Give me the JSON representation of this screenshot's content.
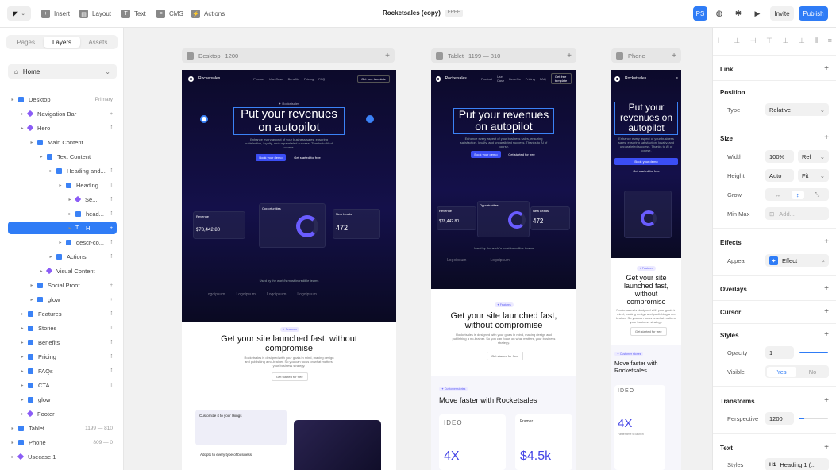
{
  "topbar": {
    "insert": "Insert",
    "layout": "Layout",
    "text": "Text",
    "cms": "CMS",
    "actions": "Actions",
    "title": "Rocketsales (copy)",
    "plan": "FREE",
    "avatar": "PS",
    "invite": "Invite",
    "publish": "Publish"
  },
  "left_panel": {
    "tabs": [
      "Pages",
      "Layers",
      "Assets"
    ],
    "page": "Home",
    "layers": [
      {
        "label": "Desktop",
        "tag": "Primary",
        "depth": 0,
        "kind": "frame"
      },
      {
        "label": "Navigation Bar",
        "tag": "+",
        "depth": 1,
        "kind": "comp"
      },
      {
        "label": "Hero",
        "tag": "⠿",
        "depth": 1,
        "kind": "comp"
      },
      {
        "label": "Main Content",
        "tag": "",
        "depth": 2,
        "kind": "stack"
      },
      {
        "label": "Text Content",
        "tag": "",
        "depth": 3,
        "kind": "stack"
      },
      {
        "label": "Heading and...",
        "tag": "⠿",
        "depth": 4,
        "kind": "stack"
      },
      {
        "label": "Heading ...",
        "tag": "⠿",
        "depth": 5,
        "kind": "stack"
      },
      {
        "label": "Se...",
        "tag": "⠿",
        "depth": 6,
        "kind": "comp"
      },
      {
        "label": "head...",
        "tag": "⠿",
        "depth": 6,
        "kind": "stack"
      },
      {
        "label": "H",
        "tag": "+",
        "depth": 6,
        "kind": "text",
        "selected": true
      },
      {
        "label": "descr-co...",
        "tag": "⠿",
        "depth": 5,
        "kind": "stack"
      },
      {
        "label": "Actions",
        "tag": "⠿",
        "depth": 4,
        "kind": "stack"
      },
      {
        "label": "Visual Content",
        "tag": "",
        "depth": 3,
        "kind": "comp"
      },
      {
        "label": "Social Proof",
        "tag": "+",
        "depth": 2,
        "kind": "stack"
      },
      {
        "label": "glow",
        "tag": "+",
        "depth": 2,
        "kind": "stack"
      },
      {
        "label": "Features",
        "tag": "⠿",
        "depth": 1,
        "kind": "stack"
      },
      {
        "label": "Stories",
        "tag": "⠿",
        "depth": 1,
        "kind": "stack"
      },
      {
        "label": "Benefits",
        "tag": "⠿",
        "depth": 1,
        "kind": "stack"
      },
      {
        "label": "Pricing",
        "tag": "⠿",
        "depth": 1,
        "kind": "stack"
      },
      {
        "label": "FAQs",
        "tag": "⠿",
        "depth": 1,
        "kind": "stack"
      },
      {
        "label": "CTA",
        "tag": "⠿",
        "depth": 1,
        "kind": "stack"
      },
      {
        "label": "glow",
        "tag": "",
        "depth": 1,
        "kind": "stack"
      },
      {
        "label": "Footer",
        "tag": "",
        "depth": 1,
        "kind": "comp"
      },
      {
        "label": "Tablet",
        "tag": "1199 — 810",
        "depth": 0,
        "kind": "frame"
      },
      {
        "label": "Phone",
        "tag": "809 — 0",
        "depth": 0,
        "kind": "frame"
      },
      {
        "label": "Usecase 1",
        "tag": "",
        "depth": 0,
        "kind": "comp"
      }
    ]
  },
  "canvas": {
    "desktop": {
      "label": "Desktop",
      "size": "1200"
    },
    "tablet": {
      "label": "Tablet",
      "size": "1199 — 810"
    },
    "phone": {
      "label": "Phone"
    },
    "site": {
      "brand": "Rocketsales",
      "nav": [
        "Product",
        "Use Case",
        "Benefits",
        "Pricing",
        "FAQ"
      ],
      "nav_cta": "Get free template",
      "kicker": "✦ Rocketsales",
      "hero_title": "Put your revenues on autopilot",
      "hero_sub": "Enhance every aspect of your business sales, ensuring satisfaction, loyalty, and unparalleled success. Thanks to AI of course.",
      "btn_primary": "Book your demo",
      "btn_secondary": "Get started for free",
      "revenue_label": "Revenue",
      "revenue": "$78,442.80",
      "opps": "Opportunities",
      "leads_label": "New Leads",
      "leads": "472",
      "trusted": "Used by the world's most incredible teams",
      "logo": "Logoipsum",
      "s2_pill": "✦ Features",
      "s2_title": "Get your site launched fast, without compromise",
      "s2_sub": "Rocketsales is designed with your goals in mind, making design and publishing a no-brainer. So you can focus on what matters, your business strategy.",
      "s2_btn": "Get started for free",
      "s3_pill": "✦ Customer stories",
      "s3_title": "Move faster with Rocketsales",
      "ideo": "IDEO",
      "stat1": "4X",
      "stat1_cap": "Faster time to launch",
      "framer": "Framer",
      "stat2": "$4.5k",
      "customize": "Customize it to your likings",
      "adopts": "Adopts to every type of business"
    }
  },
  "right_panel": {
    "link": "Link",
    "position": "Position",
    "type_label": "Type",
    "type_value": "Relative",
    "size": "Size",
    "width_label": "Width",
    "width_value": "100%",
    "width_unit": "Rel",
    "height_label": "Height",
    "height_value": "Auto",
    "height_unit": "Fit",
    "grow_label": "Grow",
    "minmax_label": "Min Max",
    "minmax_placeholder": "Add...",
    "effects": "Effects",
    "appear_label": "Appear",
    "appear_value": "Effect",
    "overlays": "Overlays",
    "cursor": "Cursor",
    "styles": "Styles",
    "opacity_label": "Opacity",
    "opacity_value": "1",
    "visible_label": "Visible",
    "visible_yes": "Yes",
    "visible_no": "No",
    "transforms": "Transforms",
    "perspective_label": "Perspective",
    "perspective_value": "1200",
    "text": "Text",
    "text_styles_label": "Styles",
    "text_styles_value": "Heading 1 (..."
  }
}
